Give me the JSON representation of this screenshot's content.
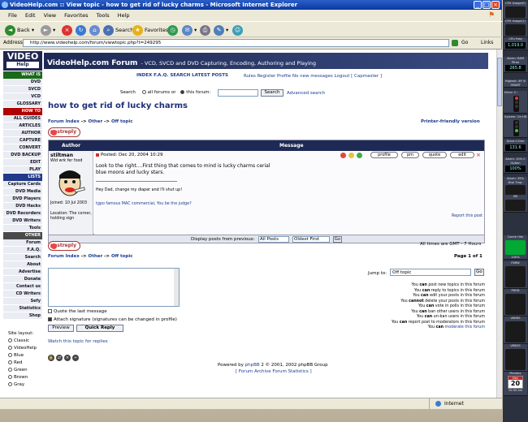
{
  "window": {
    "title": "VideoHelp.com :: View topic - how to get rid of lucky charms - Microsoft Internet Explorer"
  },
  "menu": [
    "File",
    "Edit",
    "View",
    "Favorites",
    "Tools",
    "Help"
  ],
  "toolbar": {
    "back": "Back",
    "search": "Search",
    "favorites": "Favorites"
  },
  "address": {
    "label": "Address",
    "url": "http://www.videohelp.com/forum/viewtopic.php?t=249295",
    "go": "Go",
    "links": "Links"
  },
  "status": {
    "zone": "Internet"
  },
  "logo": {
    "top": "VIDEO",
    "bottom": "Help"
  },
  "banner": {
    "title": "VideoHelp.com Forum",
    "subtitle": "- VCD, SVCD and DVD Capturing, Encoding, Authoring and Playing"
  },
  "nav": {
    "whatis": {
      "head": "WHAT IS",
      "items": [
        "DVD",
        "SVCD",
        "VCD",
        "GLOSSARY"
      ]
    },
    "howto": {
      "head": "HOW TO",
      "items": [
        "ALL GUIDES",
        "ARTICLES",
        "AUTHOR",
        "CAPTURE",
        "CONVERT",
        "DVD BACKUP",
        "EDIT",
        "PLAY"
      ]
    },
    "lists": {
      "head": "LISTS",
      "items": [
        "Capture Cards",
        "DVD Media",
        "DVD Players",
        "DVD Hacks",
        "DVD Recorders",
        "DVD Writers",
        "Tools"
      ]
    },
    "other": {
      "head": "OTHER",
      "items": [
        "Forum",
        "F.A.Q.",
        "Search",
        "About",
        "Advertise",
        "Donate",
        "Contact us",
        "CD Writers",
        "Sefy",
        "Statistics",
        "Shop"
      ]
    }
  },
  "site_layout": {
    "label": "Site layout:",
    "options": [
      "Classic",
      "VideoHelp",
      "Blue",
      "Red",
      "Green",
      "Brown",
      "Gray"
    ]
  },
  "topnav": {
    "index": "INDEX",
    "faq": "F.A.Q.",
    "search": "SEARCH",
    "latest": "LATEST POSTS",
    "rules": "Rules",
    "register": "Register",
    "profile": "Profile",
    "no_new": "No new messages",
    "logout": "Logout [ Capmaster ]"
  },
  "search": {
    "label": "Search",
    "all": "all forums or",
    "this": "this forum:",
    "button": "Search",
    "advanced": "Advanced search"
  },
  "topic": {
    "title": "how to get rid of lucky charms",
    "bc_index": "Forum Index",
    "bc_sep": "->",
    "bc_other": "Other",
    "bc_topic": "Off topic",
    "printer": "Printer-friendly version",
    "postreply": "postreply"
  },
  "table": {
    "col_author": "Author",
    "col_message": "Message"
  },
  "post": {
    "author": "stiltman",
    "rank": "Wid wrk fer food",
    "joined": "Joined: 10 Jul 2003",
    "location": "Location: The corner, holding sign",
    "posted": "Posted: Dec 20, 2004 10:29",
    "line1": "Look to the right....First thing that comes to mind is lucky charms cerial",
    "line2": "blue moons and lucky stars.",
    "sig1": "Hey Dad, change my diaper and I'll shut up!",
    "sig2": "tgpo famous MAC commercial, You be the judge?",
    "report": "Report this post",
    "btn_profile": "profile",
    "btn_pm": "pm",
    "btn_quote": "quote",
    "btn_edit": "edit"
  },
  "display": {
    "label": "Display posts from previous:",
    "sel1": "All Posts",
    "sel2": "Oldest First",
    "go": "Go"
  },
  "times": {
    "text": "All times are GMT - 7 Hours"
  },
  "page": {
    "text": "Page 1 of 1"
  },
  "jump": {
    "label": "Jump to:",
    "selected": "Off topic",
    "go": "Go"
  },
  "permissions": [
    {
      "pre": "You",
      "bold": "can",
      "post": "post new topics in this forum"
    },
    {
      "pre": "You",
      "bold": "can",
      "post": "reply to topics in this forum"
    },
    {
      "pre": "You",
      "bold": "can",
      "post": "edit your posts in this forum"
    },
    {
      "pre": "You",
      "bold": "cannot",
      "post": "delete your posts in this forum"
    },
    {
      "pre": "You",
      "bold": "can",
      "post": "vote in polls in this forum"
    },
    {
      "pre": "You",
      "bold": "can",
      "post": "ban other users in this forum"
    },
    {
      "pre": "You",
      "bold": "can",
      "post": "un-ban users in this forum"
    },
    {
      "pre": "You",
      "bold": "can",
      "post": "report post to moderators in this forum"
    },
    {
      "pre": "You",
      "bold": "can",
      "post": "moderate this forum"
    }
  ],
  "quick": {
    "quote": "Quote the last message",
    "attach": "Attach signature (signatures can be changed in profile)",
    "preview": "Preview",
    "reply": "Quick Reply",
    "watch": "Watch this topic for replies"
  },
  "footer": {
    "powered_pre": "Powered by",
    "phpbb": "phpBB",
    "powered_post": "2 © 2001, 2002 phpBB Group",
    "stats": "[ Forum Archive Forum Statistics ]"
  },
  "gadgets": {
    "cpu1": "CPU Usage(0)",
    "cpu2": "CPU Usage(1)",
    "cpufreq": "CPU Freq",
    "cpufreq_val": "1,019.0",
    "ram": "Alarm: RAM Pfree",
    "ram_val": "265.8",
    "hd": "Highest: 49 % SMART",
    "drive": "Drive: C:",
    "system": "System: On HD",
    "drivec": "Drive:C:free",
    "drivec_val": "131.6",
    "cpu_opt": "Alarm: 10% C Option",
    "cpu_opt_val": "100%",
    "disk": "Alarm: 35% Disk Tmp:",
    "kb": "KB",
    "cache": "Cache Hits",
    "pct": "100%",
    "fbrw": "FBRW",
    "fbhd": "FBHD",
    "vkb": "VKBRS",
    "vkbg": "VKBGS",
    "cal_day": "Monday",
    "cal_month": "Dec",
    "cal_date": "20",
    "clock": "10:30 am"
  }
}
